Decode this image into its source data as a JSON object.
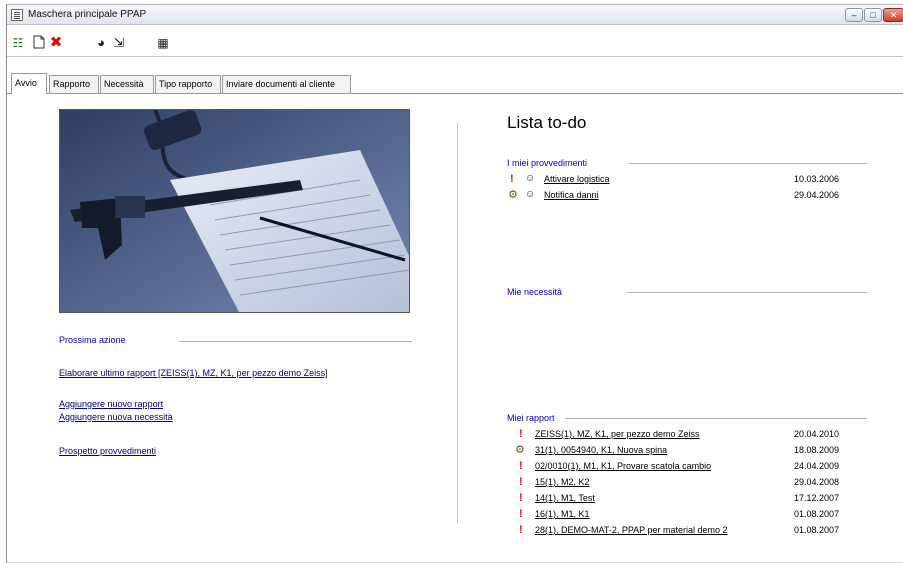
{
  "window": {
    "title": "Maschera principale PPAP"
  },
  "title_buttons": {
    "minimize": "–",
    "maximize": "□",
    "close": "✕"
  },
  "toolbar_icons": [
    "tree-icon",
    "new-document-icon",
    "delete-icon",
    "chart-icon",
    "export-icon",
    "calculator-icon"
  ],
  "toolbar_glyphs": {
    "tree": "☷",
    "new": "🗋",
    "delete": "✖",
    "chart": "◕",
    "export": "⇲",
    "calc": "▦"
  },
  "tabs": [
    {
      "label": "Avvio",
      "active": true
    },
    {
      "label": "Rapporto",
      "active": false
    },
    {
      "label": "Necessità",
      "active": false
    },
    {
      "label": "Tipo rapporto",
      "active": false
    },
    {
      "label": "Inviare documenti al cliente",
      "active": false
    }
  ],
  "left": {
    "next_action_label": "Prossima azione",
    "actions": [
      "Elaborare ultimo rapport [ZEISS(1), MZ, K1, per pezzo demo Zeiss]",
      "Aggiungere nuovo rapport",
      "Aggiungere nuova necessità",
      "Prospetto provvedimenti"
    ]
  },
  "right": {
    "title": "Lista to-do",
    "my_measures_label": "I miei provvedimenti",
    "my_measures": [
      {
        "status": "!",
        "text": "Attivare logistica",
        "date": "10.03.2006"
      },
      {
        "status": "gear",
        "text": "Notifica danni",
        "date": "29.04.2006"
      }
    ],
    "my_needs_label": "Mie necessità",
    "my_reports_label": "Miei rapport",
    "my_reports": [
      {
        "status": "!",
        "text": "ZEISS(1), MZ, K1, per pezzo demo Zeiss",
        "date": "20.04.2010"
      },
      {
        "status": "gear",
        "text": "31(1), 0054940, K1, Nuova spina",
        "date": "18.08.2009"
      },
      {
        "status": "!",
        "text": "02/0010(1), M1, K1, Provare scatola cambio",
        "date": "24.04.2009"
      },
      {
        "status": "!",
        "text": "15(1), M2, K2",
        "date": "29.04.2008"
      },
      {
        "status": "!",
        "text": "14(1), M1, Test",
        "date": "17.12.2007"
      },
      {
        "status": "!",
        "text": "16(1), M1, K1",
        "date": "01.08.2007"
      },
      {
        "status": "!",
        "text": "28(1), DEMO-MAT-2, PPAP per material demo 2",
        "date": "01.08.2007"
      }
    ],
    "glyphs": {
      "warning": "!",
      "gear": "⚙",
      "person": "☺"
    }
  },
  "colors": {
    "link": "#000080",
    "section": "#0000c8",
    "warning": "#e01010"
  }
}
